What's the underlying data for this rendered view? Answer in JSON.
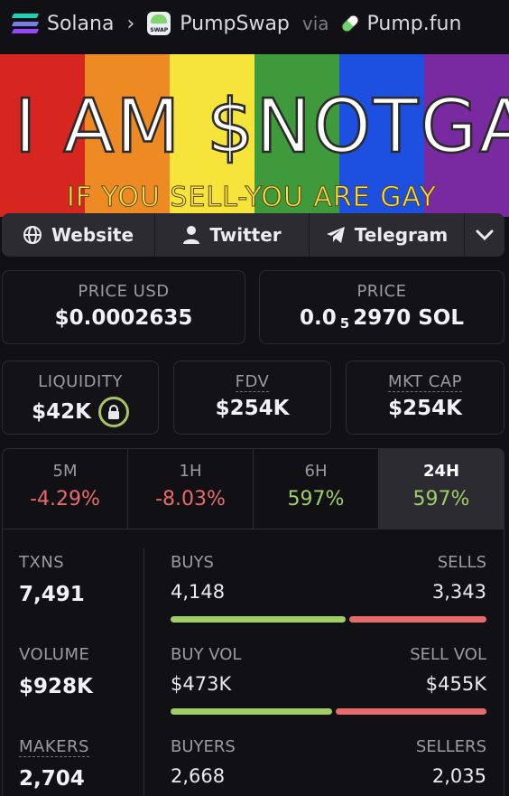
{
  "breadcrumb": {
    "chain": "Solana",
    "dex": "PumpSwap",
    "via": "via",
    "launchpad": "Pump.fun"
  },
  "banner": {
    "headline": "I AM $NOTGAY",
    "tagline": "IF YOU SELL-YOU ARE GAY",
    "stripe_colors": [
      "#d6261f",
      "#ee8a23",
      "#f6e43a",
      "#3e9a3a",
      "#1d4fe0",
      "#7a2aa0"
    ]
  },
  "links": {
    "website": "Website",
    "twitter": "Twitter",
    "telegram": "Telegram"
  },
  "price": {
    "usd_label": "PRICE USD",
    "usd_value": "$0.0002635",
    "native_label": "PRICE",
    "native_prefix": "0.0",
    "native_zeros": "5",
    "native_digits": "2970 SOL"
  },
  "metrics": {
    "liquidity_label": "LIQUIDITY",
    "liquidity_value": "$42K",
    "fdv_label": "FDV",
    "fdv_value": "$254K",
    "mcap_label": "MKT CAP",
    "mcap_value": "$254K"
  },
  "timeframes": [
    {
      "label": "5M",
      "change": "-4.29%"
    },
    {
      "label": "1H",
      "change": "-8.03%"
    },
    {
      "label": "6H",
      "change": "597%"
    },
    {
      "label": "24H",
      "change": "597%"
    }
  ],
  "stats": {
    "txns_label": "TXNS",
    "txns_value": "7,491",
    "buys_label": "BUYS",
    "buys_value": "4,148",
    "sells_label": "SELLS",
    "sells_value": "3,343",
    "buys_share": 0.554,
    "volume_label": "VOLUME",
    "volume_value": "$928K",
    "buy_vol_label": "BUY VOL",
    "buy_vol_value": "$473K",
    "sell_vol_label": "SELL VOL",
    "sell_vol_value": "$455K",
    "buy_vol_share": 0.51,
    "makers_label": "MAKERS",
    "makers_value": "2,704",
    "buyers_label": "BUYERS",
    "buyers_value": "2,668",
    "sellers_label": "SELLERS",
    "sellers_value": "2,035"
  },
  "colors": {
    "positive": "#9fcf63",
    "negative": "#e96a6a",
    "lock_ring": "#a8c35f"
  }
}
